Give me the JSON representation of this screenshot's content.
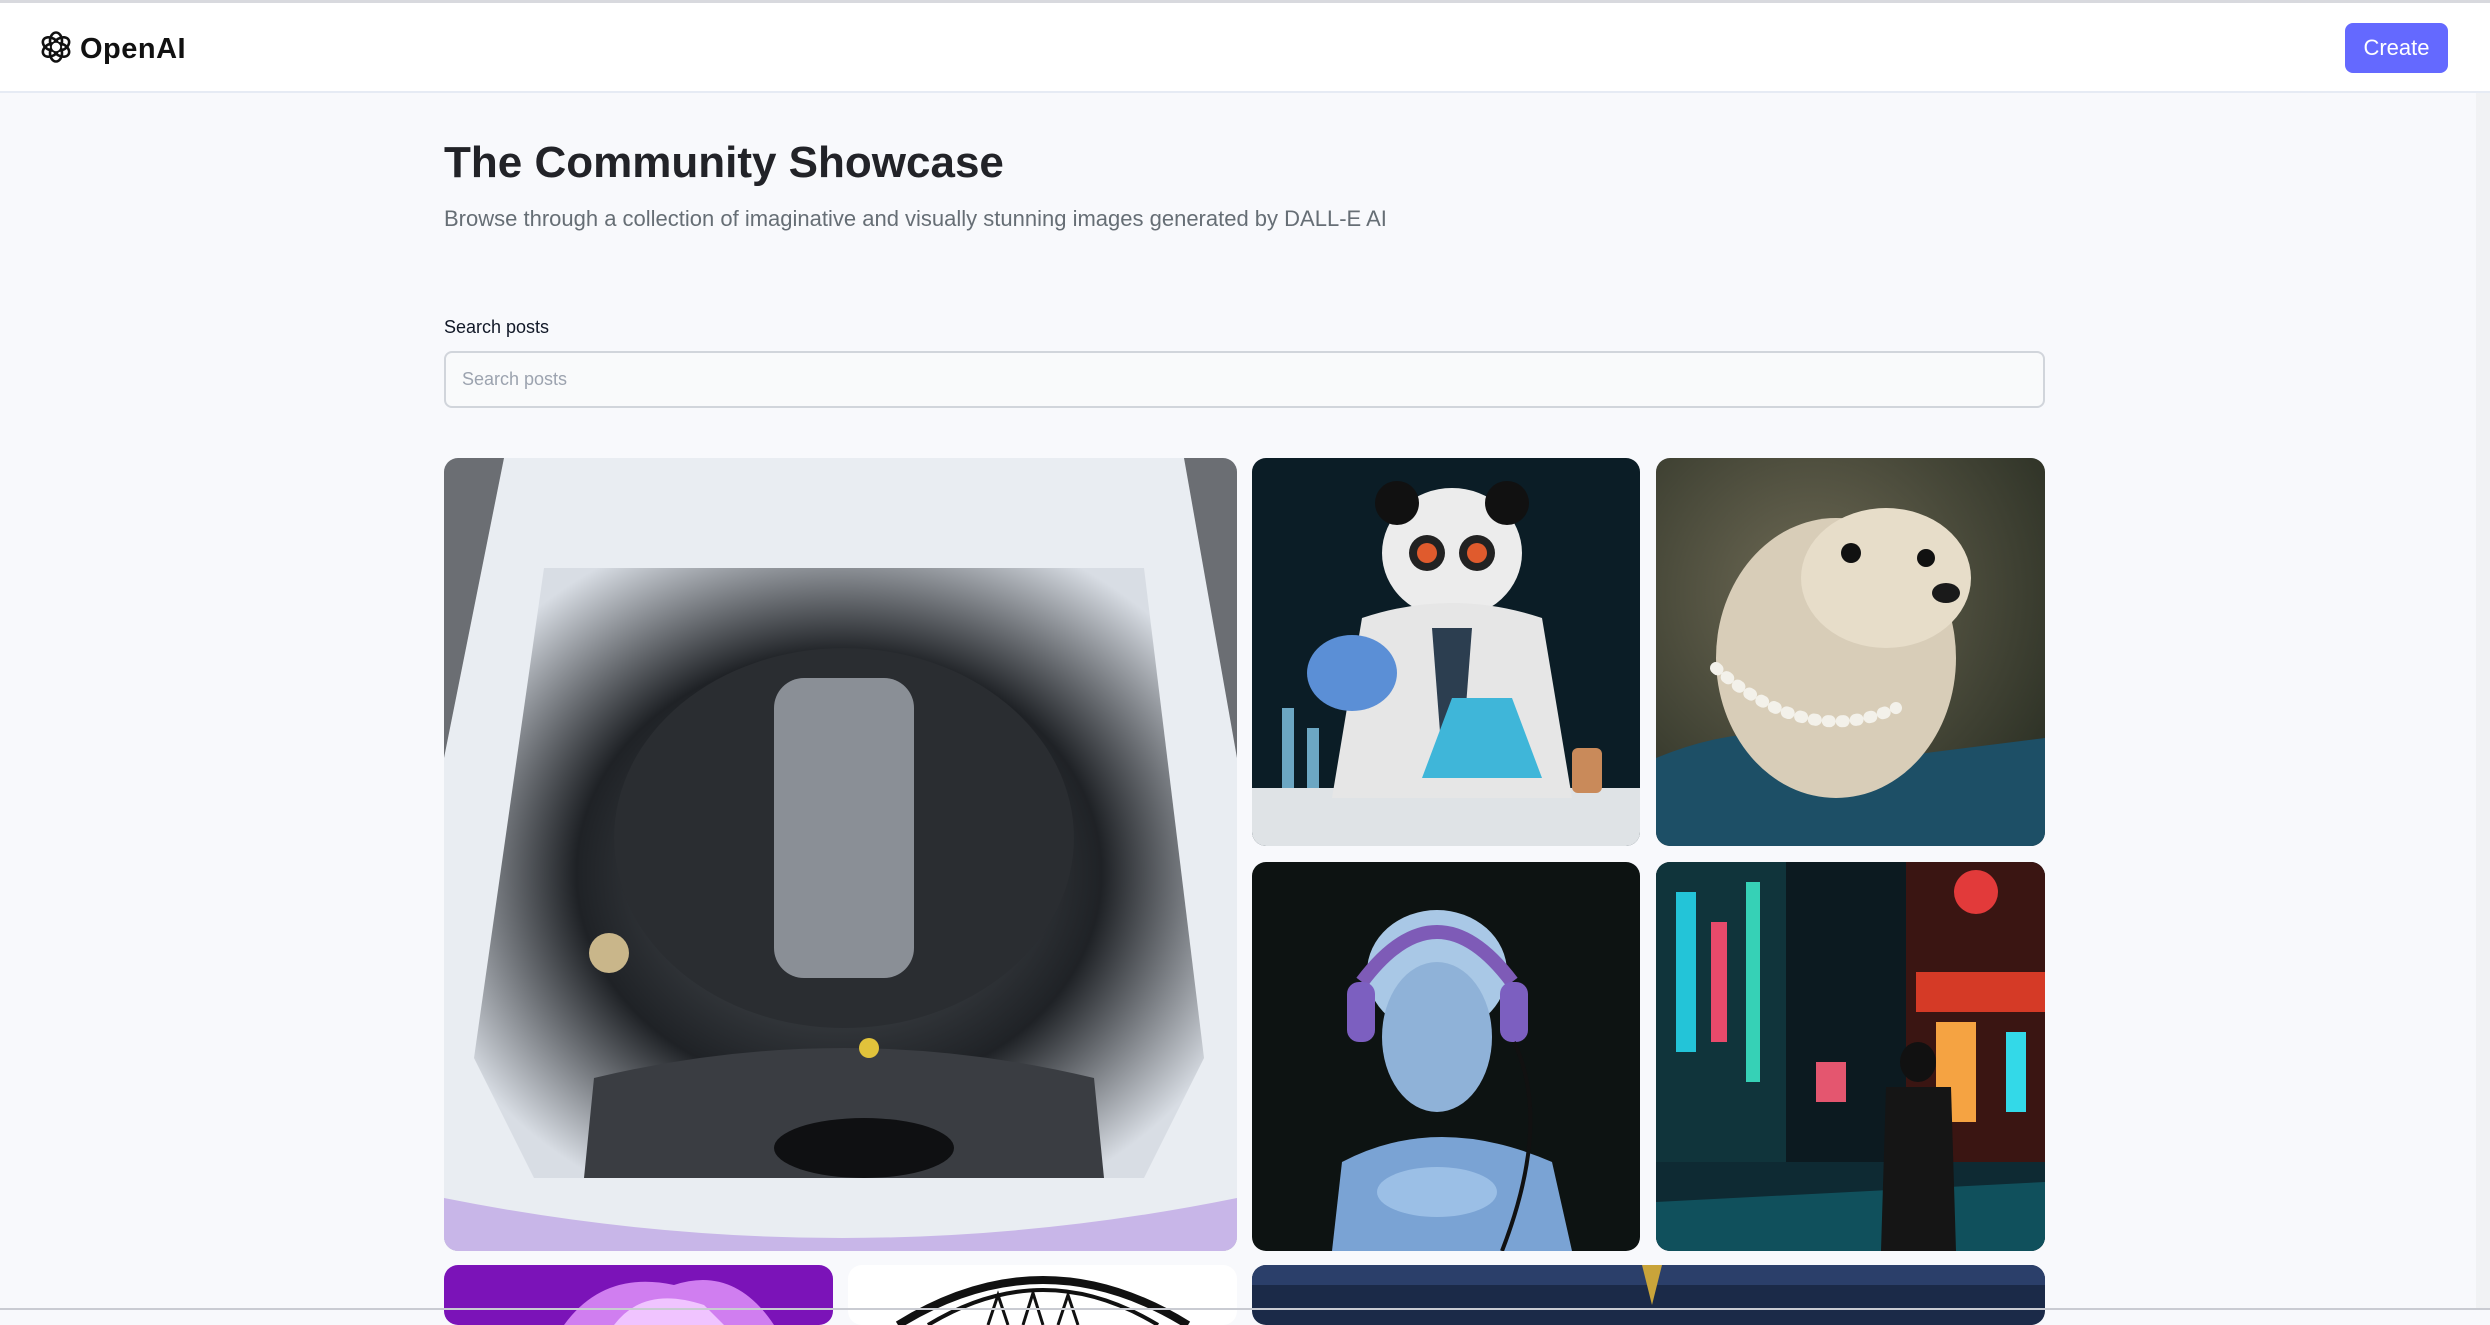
{
  "header": {
    "logo_text": "OpenAI",
    "logo_icon": "openai-logo-icon",
    "create_label": "Create",
    "accent_color": "#6469ff"
  },
  "main": {
    "title": "The Community Showcase",
    "subtitle": "Browse through a collection of imaginative and visually stunning images generated by DALL-E AI"
  },
  "search": {
    "label": "Search posts",
    "placeholder": "Search posts",
    "value": ""
  },
  "gallery": {
    "cards": [
      {
        "id": "engine-bay"
      },
      {
        "id": "panda-scientist"
      },
      {
        "id": "otter-pearls"
      },
      {
        "id": "statue-headphones"
      },
      {
        "id": "neon-city-street"
      },
      {
        "id": "purple-fur"
      },
      {
        "id": "sunburst-emblem"
      },
      {
        "id": "dark-landscape"
      }
    ]
  }
}
